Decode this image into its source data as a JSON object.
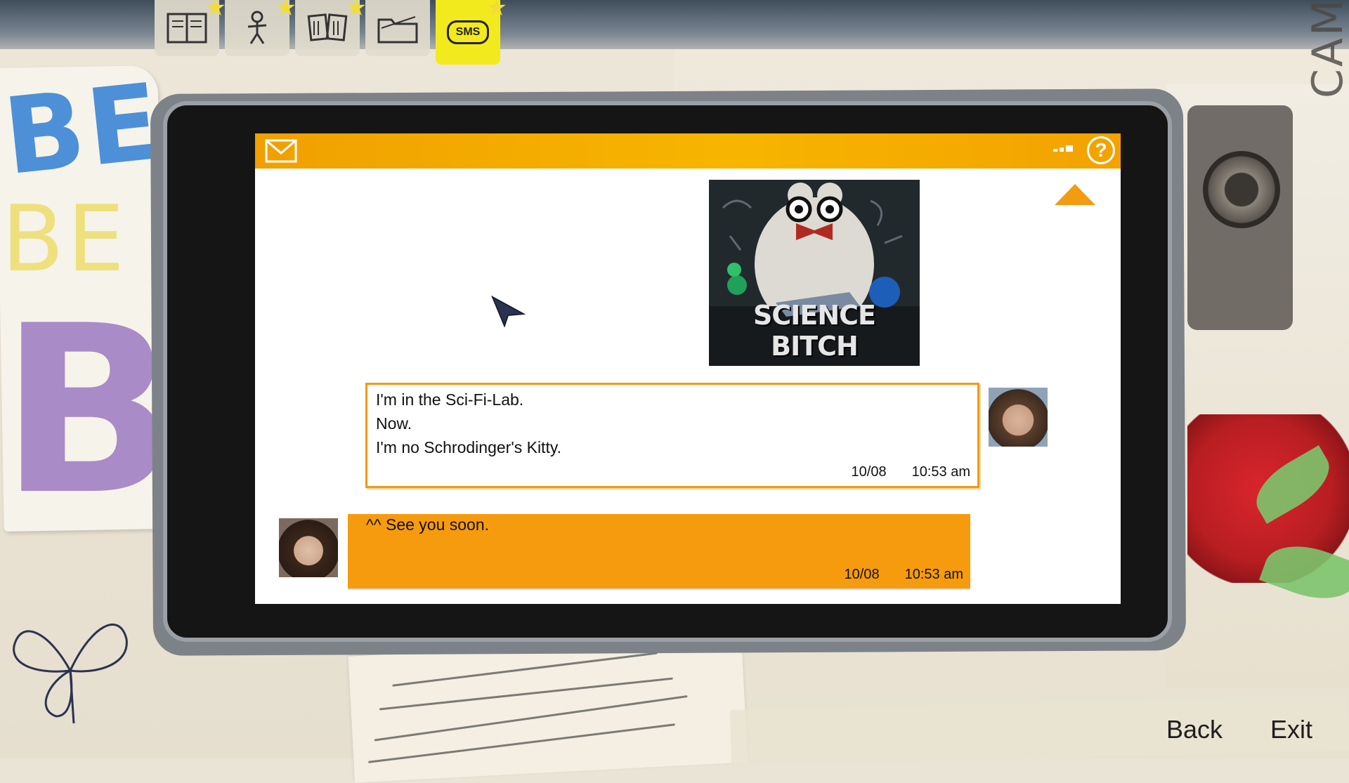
{
  "tabs": [
    {
      "name": "journal",
      "icon": "journal-icon",
      "starred": true,
      "active": false
    },
    {
      "name": "characters",
      "icon": "stick-figure-icon",
      "starred": true,
      "active": false
    },
    {
      "name": "photos",
      "icon": "photos-icon",
      "starred": true,
      "active": false
    },
    {
      "name": "collectibles",
      "icon": "folder-icon",
      "starred": false,
      "active": false
    },
    {
      "name": "sms",
      "icon": "sms-icon",
      "label": "SMS",
      "starred": true,
      "active": true
    }
  ],
  "decor": {
    "left_letters_1": "BE",
    "left_letters_2": "BE",
    "left_letters_3": "BI",
    "right_vertical_text": "CAMERA, A MAGICIAN"
  },
  "phone": {
    "header": {
      "mail_icon": "envelope-icon",
      "help_icon": "help-icon",
      "help_symbol": "?"
    },
    "attachment": {
      "caption": "SCIENCE BITCH"
    },
    "messages": [
      {
        "direction": "incoming",
        "lines": [
          "I'm in the Sci-Fi-Lab.",
          "Now.",
          "I'm no Schrodinger's Kitty."
        ],
        "date": "10/08",
        "time": "10:53 am"
      },
      {
        "direction": "outgoing",
        "lines": [
          "^^ See you soon."
        ],
        "date": "10/08",
        "time": "10:53 am"
      }
    ]
  },
  "footer": {
    "back_label": "Back",
    "exit_label": "Exit"
  },
  "colors": {
    "accent_orange": "#f69b0e",
    "tab_active_yellow": "#f3ea1d",
    "star_yellow": "#f2dd37"
  }
}
